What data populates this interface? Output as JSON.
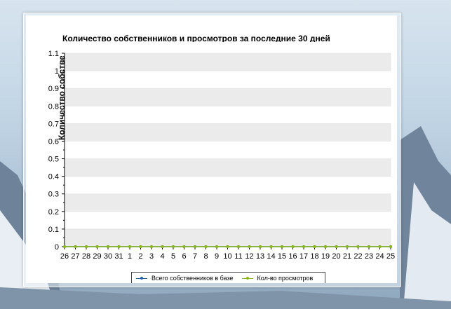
{
  "chart_data": {
    "type": "line",
    "title": "Количество собственников и просмотров за последние 30 дней",
    "ylabel": "Количество собственников в сутки",
    "xlabel": "",
    "categories": [
      "26",
      "27",
      "28",
      "29",
      "30",
      "31",
      "1",
      "2",
      "3",
      "4",
      "5",
      "6",
      "7",
      "8",
      "9",
      "10",
      "11",
      "12",
      "13",
      "14",
      "15",
      "16",
      "17",
      "18",
      "19",
      "20",
      "21",
      "22",
      "23",
      "24",
      "25"
    ],
    "series": [
      {
        "name": "Всего собственников в базе",
        "color": "#1f5fa8",
        "values": [
          0,
          0,
          0,
          0,
          0,
          0,
          0,
          0,
          0,
          0,
          0,
          0,
          0,
          0,
          0,
          0,
          0,
          0,
          0,
          0,
          0,
          0,
          0,
          0,
          0,
          0,
          0,
          0,
          0,
          0,
          0
        ]
      },
      {
        "name": "Кол-во просмотров",
        "color": "#8cb81a",
        "values": [
          0,
          0,
          0,
          0,
          0,
          0,
          0,
          0,
          0,
          0,
          0,
          0,
          0,
          0,
          0,
          0,
          0,
          0,
          0,
          0,
          0,
          0,
          0,
          0,
          0,
          0,
          0,
          0,
          0,
          0,
          0
        ]
      }
    ],
    "ylim": [
      0,
      1.1
    ],
    "yticks": [
      "0",
      "0.1",
      "0.2",
      "0.3",
      "0.4",
      "0.5",
      "0.6",
      "0.7",
      "0.8",
      "0.9",
      "1",
      "1.1"
    ],
    "grid": true,
    "legend_position": "bottom"
  },
  "colors": {
    "band": "#ebebeb",
    "axis": "#000000"
  }
}
